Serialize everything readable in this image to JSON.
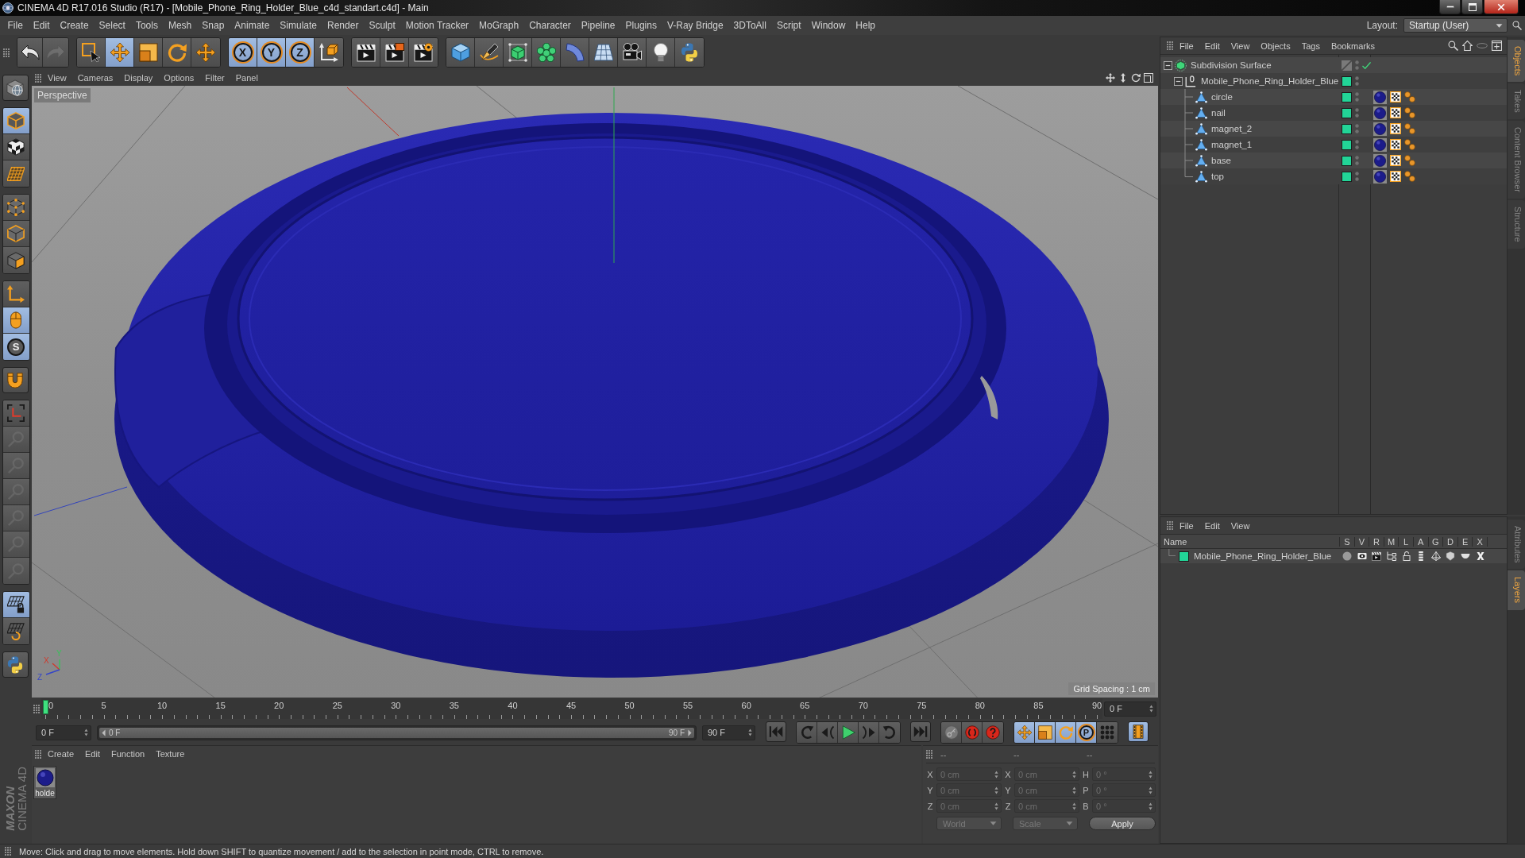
{
  "window": {
    "title": "CINEMA 4D R17.016 Studio (R17) - [Mobile_Phone_Ring_Holder_Blue_c4d_standart.c4d] - Main"
  },
  "menu_bar": {
    "items": [
      "File",
      "Edit",
      "Create",
      "Select",
      "Tools",
      "Mesh",
      "Snap",
      "Animate",
      "Simulate",
      "Render",
      "Sculpt",
      "Motion Tracker",
      "MoGraph",
      "Character",
      "Pipeline",
      "Plugins",
      "V-Ray Bridge",
      "3DToAll",
      "Script",
      "Window",
      "Help"
    ],
    "layout_label": "Layout:",
    "layout_value": "Startup (User)"
  },
  "toolbar": {
    "groups": [
      [
        {
          "kind": "undo",
          "selected": false,
          "disabled": false
        },
        {
          "kind": "redo",
          "selected": false,
          "disabled": true
        }
      ],
      [
        {
          "kind": "live_selection",
          "selected": false,
          "disabled": false
        },
        {
          "kind": "move",
          "selected": true,
          "disabled": false
        },
        {
          "kind": "scale",
          "selected": false,
          "disabled": false
        },
        {
          "kind": "rotate",
          "selected": false,
          "disabled": false
        },
        {
          "kind": "last_tool",
          "selected": false,
          "disabled": false
        }
      ],
      [
        {
          "kind": "axis_toggle",
          "label": "X",
          "selected": true,
          "disabled": false
        },
        {
          "kind": "axis_toggle",
          "label": "Y",
          "selected": true,
          "disabled": false
        },
        {
          "kind": "axis_toggle",
          "label": "Z",
          "selected": true,
          "disabled": false
        },
        {
          "kind": "coordinate_system",
          "selected": false,
          "disabled": false
        }
      ],
      [
        {
          "kind": "render_view",
          "selected": false,
          "disabled": false
        },
        {
          "kind": "render_picture",
          "selected": false,
          "disabled": false
        },
        {
          "kind": "render_settings",
          "selected": false,
          "disabled": false
        }
      ],
      [
        {
          "kind": "cube",
          "selected": false,
          "disabled": false
        },
        {
          "kind": "pen",
          "selected": false,
          "disabled": false
        },
        {
          "kind": "subdivision",
          "selected": false,
          "disabled": false
        },
        {
          "kind": "cloner",
          "selected": false,
          "disabled": false
        },
        {
          "kind": "deformer",
          "selected": false,
          "disabled": false
        },
        {
          "kind": "floor",
          "selected": false,
          "disabled": false
        },
        {
          "kind": "camera",
          "selected": false,
          "disabled": false
        },
        {
          "kind": "light",
          "selected": false,
          "disabled": false
        },
        {
          "kind": "script",
          "selected": false,
          "disabled": false
        }
      ]
    ]
  },
  "left_toolbar": {
    "groups": [
      [
        {
          "kind": "make_editable",
          "selected": false,
          "disabled": false
        }
      ],
      [
        {
          "kind": "model",
          "selected": true,
          "disabled": false
        },
        {
          "kind": "texture",
          "selected": false,
          "disabled": false
        },
        {
          "kind": "workplane",
          "selected": false,
          "disabled": false
        }
      ],
      [
        {
          "kind": "points",
          "selected": false,
          "disabled": false
        },
        {
          "kind": "edges",
          "selected": false,
          "disabled": false
        },
        {
          "kind": "polygons",
          "selected": false,
          "disabled": false
        }
      ],
      [
        {
          "kind": "axis",
          "selected": false,
          "disabled": false
        },
        {
          "kind": "tweak",
          "selected": true,
          "disabled": false
        },
        {
          "kind": "snap",
          "label": "S",
          "selected": true,
          "disabled": false
        }
      ],
      [
        {
          "kind": "magnet",
          "selected": false,
          "disabled": false
        }
      ],
      [
        {
          "kind": "axis_brackets",
          "selected": false,
          "disabled": false
        },
        {
          "kind": "locked_tool",
          "selected": false,
          "disabled": true
        },
        {
          "kind": "locked_tool",
          "selected": false,
          "disabled": true
        },
        {
          "kind": "locked_tool",
          "selected": false,
          "disabled": true
        },
        {
          "kind": "locked_tool",
          "selected": false,
          "disabled": true
        },
        {
          "kind": "locked_tool",
          "selected": false,
          "disabled": true
        },
        {
          "kind": "locked_tool",
          "selected": false,
          "disabled": true
        }
      ],
      [
        {
          "kind": "workplane_lock",
          "selected": true,
          "disabled": false
        },
        {
          "kind": "workplane_align",
          "selected": false,
          "disabled": false
        }
      ],
      [
        {
          "kind": "script",
          "selected": false,
          "disabled": false
        }
      ]
    ]
  },
  "logo": {
    "brand": "MAXON",
    "product": "CINEMA 4D"
  },
  "viewport": {
    "menu": [
      "View",
      "Cameras",
      "Display",
      "Options",
      "Filter",
      "Panel"
    ],
    "camera": "Perspective",
    "grid_spacing": "Grid Spacing : 1 cm",
    "axis_labels": [
      "Y",
      "X",
      "Z"
    ]
  },
  "timeline": {
    "labels": [
      "0",
      "5",
      "10",
      "15",
      "20",
      "25",
      "30",
      "35",
      "40",
      "45",
      "50",
      "55",
      "60",
      "65",
      "70",
      "75",
      "80",
      "85",
      "90"
    ],
    "level": 0,
    "frame_field": "0 F"
  },
  "transport": {
    "start_field": "0 F",
    "range": {
      "start": "0 F",
      "end": "90 F",
      "level": 1
    },
    "end_field": "90 F",
    "groups": [
      [
        {
          "kind": "go_start",
          "selected": false
        }
      ],
      [
        {
          "kind": "prev_key",
          "selected": false
        },
        {
          "kind": "prev_frame",
          "selected": false
        },
        {
          "kind": "play",
          "selected": false
        },
        {
          "kind": "next_frame",
          "selected": false
        },
        {
          "kind": "next_key",
          "selected": false
        }
      ],
      [
        {
          "kind": "go_end",
          "selected": false
        }
      ],
      [
        {
          "kind": "autokey",
          "selected": false
        },
        {
          "kind": "record",
          "selected": false
        },
        {
          "kind": "help",
          "selected": false
        }
      ],
      [
        {
          "kind": "key_move",
          "selected": true
        },
        {
          "kind": "key_scale",
          "selected": true
        },
        {
          "kind": "key_rotate",
          "selected": true
        },
        {
          "kind": "key_param",
          "label": "P",
          "selected": true
        },
        {
          "kind": "key_points",
          "selected": false
        }
      ],
      [
        {
          "kind": "timeline",
          "selected": true
        }
      ]
    ]
  },
  "material_manager": {
    "menu": [
      "Create",
      "Edit",
      "Function",
      "Texture"
    ],
    "materials": [
      {
        "name": "holde",
        "selected": false
      }
    ]
  },
  "coordinates": {
    "headers": [
      "--",
      "--",
      "--"
    ],
    "rows": [
      {
        "cells": [
          {
            "label": "X",
            "value": "0 cm",
            "disabled": true
          },
          {
            "label": "X",
            "value": "0 cm",
            "disabled": true
          },
          {
            "label": "H",
            "value": "0 °",
            "disabled": true
          }
        ]
      },
      {
        "cells": [
          {
            "label": "Y",
            "value": "0 cm",
            "disabled": true
          },
          {
            "label": "Y",
            "value": "0 cm",
            "disabled": true
          },
          {
            "label": "P",
            "value": "0 °",
            "disabled": true
          }
        ]
      },
      {
        "cells": [
          {
            "label": "Z",
            "value": "0 cm",
            "disabled": true
          },
          {
            "label": "Z",
            "value": "0 cm",
            "disabled": true
          },
          {
            "label": "B",
            "value": "0 °",
            "disabled": true
          }
        ]
      }
    ],
    "controls": [
      {
        "kind": "dropdown",
        "label": "World",
        "disabled": true
      },
      {
        "kind": "dropdown",
        "label": "Scale",
        "disabled": true
      },
      {
        "kind": "button",
        "label": "Apply",
        "disabled": false
      }
    ]
  },
  "object_manager": {
    "menu": [
      "File",
      "Edit",
      "View",
      "Objects",
      "Tags",
      "Bookmarks"
    ],
    "tree": [
      {
        "name": "Subdivision Surface",
        "kind": "subdivision",
        "expanded": true,
        "enabled": true,
        "selected": false,
        "children": [
          {
            "name": "Mobile_Phone_Ring_Holder_Blue",
            "kind": "null",
            "expanded": true,
            "selected": false,
            "color": "#22d497",
            "children": [
              {
                "name": "circle",
                "kind": "polygon",
                "selected": false,
                "color": "#22d497",
                "tags": [
                  {
                    "kind": "material"
                  },
                  {
                    "kind": "uvw"
                  },
                  {
                    "kind": "selection"
                  }
                ]
              },
              {
                "name": "nail",
                "kind": "polygon",
                "selected": false,
                "color": "#22d497",
                "tags": [
                  {
                    "kind": "material"
                  },
                  {
                    "kind": "uvw"
                  },
                  {
                    "kind": "selection"
                  }
                ]
              },
              {
                "name": "magnet_2",
                "kind": "polygon",
                "selected": false,
                "color": "#22d497",
                "tags": [
                  {
                    "kind": "material"
                  },
                  {
                    "kind": "uvw"
                  },
                  {
                    "kind": "selection"
                  }
                ]
              },
              {
                "name": "magnet_1",
                "kind": "polygon",
                "selected": false,
                "color": "#22d497",
                "tags": [
                  {
                    "kind": "material"
                  },
                  {
                    "kind": "uvw"
                  },
                  {
                    "kind": "selection"
                  }
                ]
              },
              {
                "name": "base",
                "kind": "polygon",
                "selected": false,
                "color": "#22d497",
                "tags": [
                  {
                    "kind": "material"
                  },
                  {
                    "kind": "uvw"
                  },
                  {
                    "kind": "selection"
                  }
                ]
              },
              {
                "name": "top",
                "kind": "polygon",
                "selected": false,
                "color": "#22d497",
                "tags": [
                  {
                    "kind": "material"
                  },
                  {
                    "kind": "uvw"
                  },
                  {
                    "kind": "selection"
                  }
                ]
              }
            ]
          }
        ]
      }
    ]
  },
  "layer_manager": {
    "menu": [
      "File",
      "Edit",
      "View"
    ],
    "columns": [
      "Name",
      "S",
      "V",
      "R",
      "M",
      "L",
      "A",
      "G",
      "D",
      "E",
      "X"
    ],
    "layers": [
      {
        "name": "Mobile_Phone_Ring_Holder_Blue",
        "color": "#22d497",
        "selected": false
      }
    ]
  },
  "side_tabs_top": [
    {
      "label": "Objects",
      "selected": true
    },
    {
      "label": "Takes",
      "selected": false
    },
    {
      "label": "Content Browser",
      "selected": false
    },
    {
      "label": "Structure",
      "selected": false
    }
  ],
  "side_tabs_bottom": [
    {
      "label": "Attributes",
      "selected": false
    },
    {
      "label": "Layers",
      "selected": true
    }
  ],
  "status_bar": {
    "text": "Move: Click and drag to move elements. Hold down SHIFT to quantize movement / add to the selection in point mode, CTRL to remove."
  }
}
